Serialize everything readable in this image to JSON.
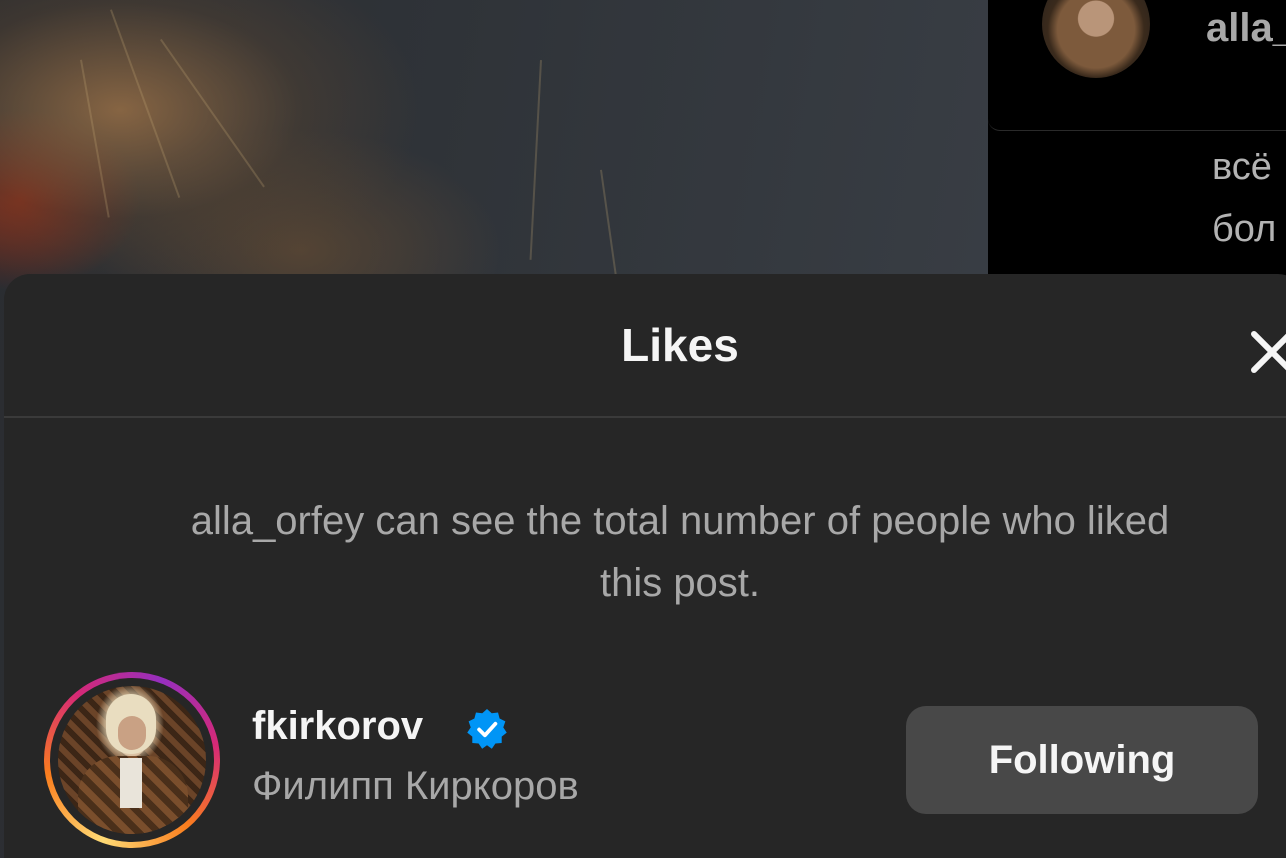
{
  "background_post": {
    "comments_header": {
      "username": "alla_"
    },
    "comment_lines": [
      "всё",
      "бол"
    ]
  },
  "likes_modal": {
    "title": "Likes",
    "info_text_line1": "alla_orfey can see the total number of people who liked",
    "info_text_line2": "this post.",
    "users": [
      {
        "username": "fkirkorov",
        "verified": true,
        "full_name": "Филипп Киркоров",
        "follow_button_label": "Following"
      }
    ]
  },
  "colors": {
    "modal_background": "#262626",
    "verified_badge": "#0095f6",
    "following_button": "#484848"
  },
  "icons": {
    "close": "close-icon",
    "verified": "verified-badge-icon"
  }
}
